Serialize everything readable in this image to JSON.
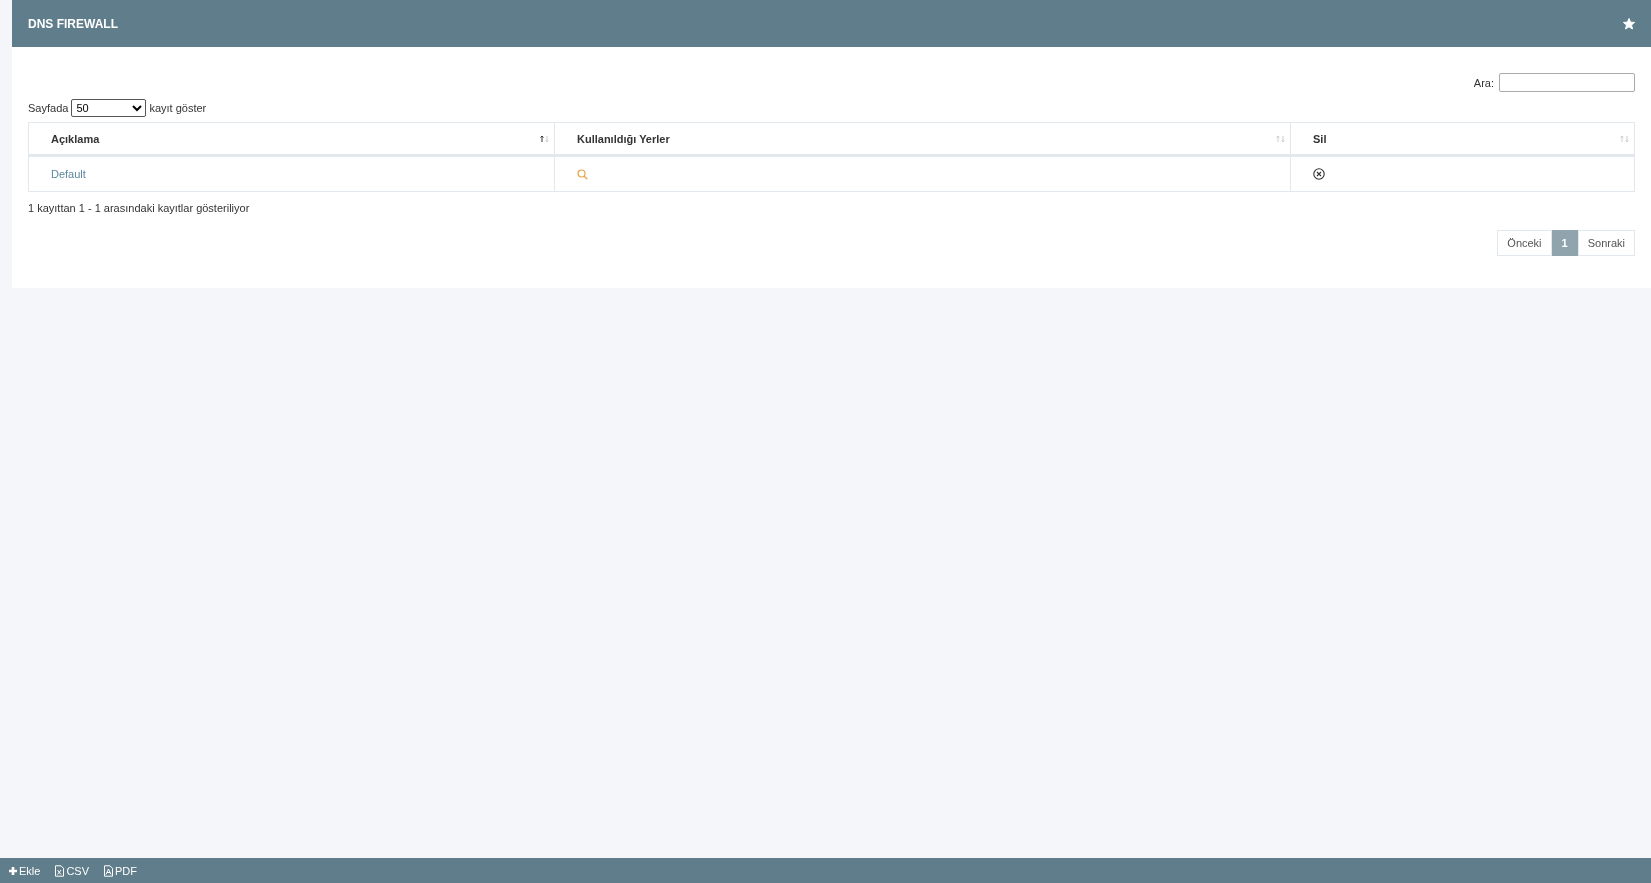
{
  "header": {
    "title": "DNS FIREWALL"
  },
  "length_menu": {
    "prefix": "Sayfada",
    "value": "50",
    "suffix": "kayıt göster"
  },
  "search": {
    "label": "Ara:"
  },
  "table": {
    "columns": [
      {
        "label": "Açıklama",
        "sorted": true
      },
      {
        "label": "Kullanıldığı Yerler",
        "sorted": false
      },
      {
        "label": "Sil",
        "sorted": false
      }
    ],
    "rows": [
      {
        "description": "Default"
      }
    ]
  },
  "info": "1 kayıttan 1 - 1 arasındaki kayıtlar gösteriliyor",
  "pagination": [
    {
      "label": "Önceki",
      "kind": "nav",
      "selected": false
    },
    {
      "label": "1",
      "kind": "page",
      "selected": true
    },
    {
      "label": "Sonraki",
      "kind": "nav",
      "selected": false
    }
  ],
  "footer": [
    {
      "label": "Ekle",
      "kind": "add"
    },
    {
      "label": "CSV",
      "kind": "csv"
    },
    {
      "label": "PDF",
      "kind": "pdf"
    }
  ]
}
